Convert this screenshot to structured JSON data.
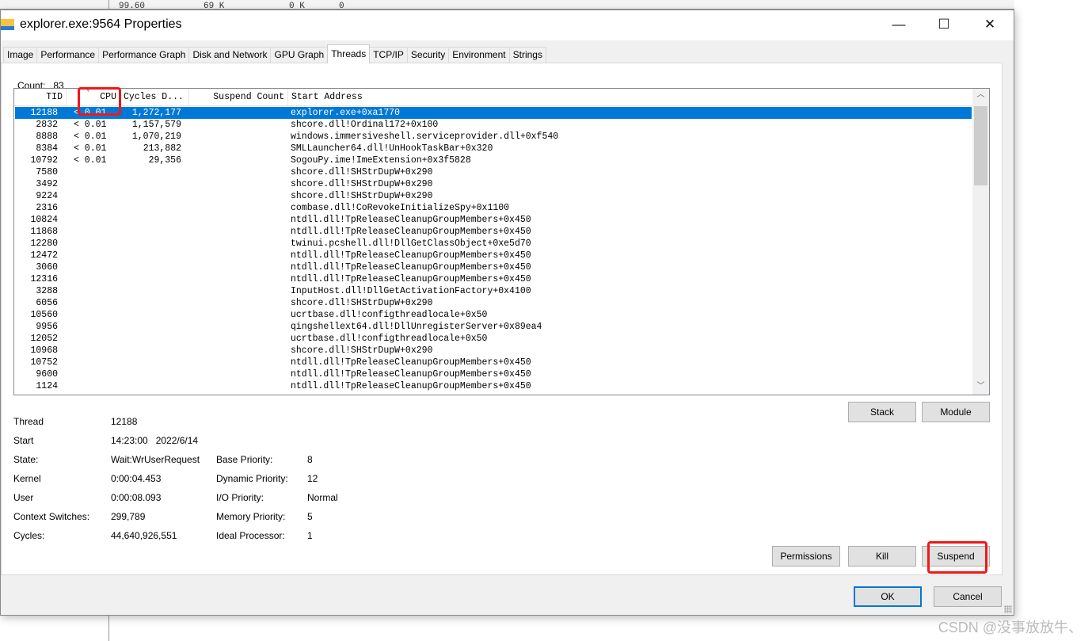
{
  "background": {
    "cells": [
      "99.60",
      "69 K",
      "0 K",
      "0"
    ]
  },
  "window": {
    "title": "explorer.exe:9564 Properties",
    "minimize": "—",
    "maximize": "☐",
    "close": "✕"
  },
  "tabs": [
    "Image",
    "Performance",
    "Performance Graph",
    "Disk and Network",
    "GPU Graph",
    "Threads",
    "TCP/IP",
    "Security",
    "Environment",
    "Strings"
  ],
  "active_tab": "Threads",
  "count": {
    "label": "Count:",
    "value": "83"
  },
  "columns": [
    "TID",
    "CPU",
    "Cycles D...",
    "Suspend Count",
    "Start Address"
  ],
  "sort_indicator": "˅",
  "rows": [
    {
      "tid": "12188",
      "cpu": "< 0.01",
      "cycles": "1,272,177",
      "suspend": "",
      "addr": "explorer.exe+0xa1770"
    },
    {
      "tid": "2832",
      "cpu": "< 0.01",
      "cycles": "1,157,579",
      "suspend": "",
      "addr": "shcore.dll!Ordinal172+0x100"
    },
    {
      "tid": "8888",
      "cpu": "< 0.01",
      "cycles": "1,070,219",
      "suspend": "",
      "addr": "windows.immersiveshell.serviceprovider.dll+0xf540"
    },
    {
      "tid": "8384",
      "cpu": "< 0.01",
      "cycles": "213,882",
      "suspend": "",
      "addr": "SMLLauncher64.dll!UnHookTaskBar+0x320"
    },
    {
      "tid": "10792",
      "cpu": "< 0.01",
      "cycles": "29,356",
      "suspend": "",
      "addr": "SogouPy.ime!ImeExtension+0x3f5828"
    },
    {
      "tid": "7580",
      "cpu": "",
      "cycles": "",
      "suspend": "",
      "addr": "shcore.dll!SHStrDupW+0x290"
    },
    {
      "tid": "3492",
      "cpu": "",
      "cycles": "",
      "suspend": "",
      "addr": "shcore.dll!SHStrDupW+0x290"
    },
    {
      "tid": "9224",
      "cpu": "",
      "cycles": "",
      "suspend": "",
      "addr": "shcore.dll!SHStrDupW+0x290"
    },
    {
      "tid": "2316",
      "cpu": "",
      "cycles": "",
      "suspend": "",
      "addr": "combase.dll!CoRevokeInitializeSpy+0x1100"
    },
    {
      "tid": "10824",
      "cpu": "",
      "cycles": "",
      "suspend": "",
      "addr": "ntdll.dll!TpReleaseCleanupGroupMembers+0x450"
    },
    {
      "tid": "11868",
      "cpu": "",
      "cycles": "",
      "suspend": "",
      "addr": "ntdll.dll!TpReleaseCleanupGroupMembers+0x450"
    },
    {
      "tid": "12280",
      "cpu": "",
      "cycles": "",
      "suspend": "",
      "addr": "twinui.pcshell.dll!DllGetClassObject+0xe5d70"
    },
    {
      "tid": "12472",
      "cpu": "",
      "cycles": "",
      "suspend": "",
      "addr": "ntdll.dll!TpReleaseCleanupGroupMembers+0x450"
    },
    {
      "tid": "3060",
      "cpu": "",
      "cycles": "",
      "suspend": "",
      "addr": "ntdll.dll!TpReleaseCleanupGroupMembers+0x450"
    },
    {
      "tid": "12316",
      "cpu": "",
      "cycles": "",
      "suspend": "",
      "addr": "ntdll.dll!TpReleaseCleanupGroupMembers+0x450"
    },
    {
      "tid": "3288",
      "cpu": "",
      "cycles": "",
      "suspend": "",
      "addr": "InputHost.dll!DllGetActivationFactory+0x4100"
    },
    {
      "tid": "6056",
      "cpu": "",
      "cycles": "",
      "suspend": "",
      "addr": "shcore.dll!SHStrDupW+0x290"
    },
    {
      "tid": "10560",
      "cpu": "",
      "cycles": "",
      "suspend": "",
      "addr": "ucrtbase.dll!configthreadlocale+0x50"
    },
    {
      "tid": "9956",
      "cpu": "",
      "cycles": "",
      "suspend": "",
      "addr": "qingshellext64.dll!DllUnregisterServer+0x89ea4"
    },
    {
      "tid": "12052",
      "cpu": "",
      "cycles": "",
      "suspend": "",
      "addr": "ucrtbase.dll!configthreadlocale+0x50"
    },
    {
      "tid": "10968",
      "cpu": "",
      "cycles": "",
      "suspend": "",
      "addr": "shcore.dll!SHStrDupW+0x290"
    },
    {
      "tid": "10752",
      "cpu": "",
      "cycles": "",
      "suspend": "",
      "addr": "ntdll.dll!TpReleaseCleanupGroupMembers+0x450"
    },
    {
      "tid": "9600",
      "cpu": "",
      "cycles": "",
      "suspend": "",
      "addr": "ntdll.dll!TpReleaseCleanupGroupMembers+0x450"
    },
    {
      "tid": "1124",
      "cpu": "",
      "cycles": "",
      "suspend": "",
      "addr": "ntdll.dll!TpReleaseCleanupGroupMembers+0x450"
    }
  ],
  "details": {
    "thread": {
      "label": "Thread",
      "value": "12188"
    },
    "start": {
      "label": "Start",
      "value": "14:23:00   2022/6/14"
    },
    "state": {
      "label": "State:",
      "value": "Wait:WrUserRequest"
    },
    "kernel": {
      "label": "Kernel",
      "value": "0:00:04.453"
    },
    "user": {
      "label": "User",
      "value": "0:00:08.093"
    },
    "context_switches": {
      "label": "Context Switches:",
      "value": "299,789"
    },
    "cycles": {
      "label": "Cycles:",
      "value": "44,640,926,551"
    },
    "base_priority": {
      "label": "Base Priority:",
      "value": "8"
    },
    "dynamic_priority": {
      "label": "Dynamic Priority:",
      "value": "12"
    },
    "io_priority": {
      "label": "I/O Priority:",
      "value": "Normal"
    },
    "memory_priority": {
      "label": "Memory Priority:",
      "value": "5"
    },
    "ideal_processor": {
      "label": "Ideal Processor:",
      "value": "1"
    }
  },
  "buttons": {
    "stack": "Stack",
    "module": "Module",
    "permissions": "Permissions",
    "kill": "Kill",
    "suspend": "Suspend",
    "ok": "OK",
    "cancel": "Cancel"
  },
  "watermark": "CSDN @没事放放牛、",
  "colors": {
    "selection": "#0078d7",
    "highlight_box": "#f01818"
  }
}
